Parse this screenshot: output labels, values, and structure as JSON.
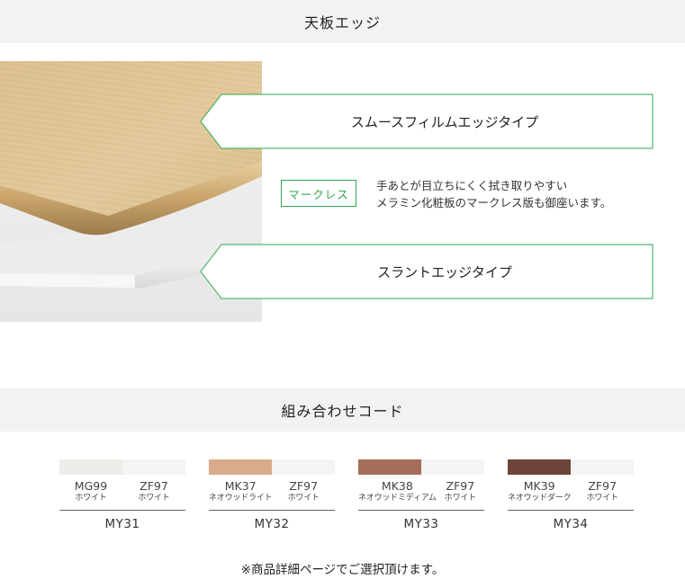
{
  "sections": {
    "edge_title": "天板エッジ",
    "combo_title": "組み合わせコード"
  },
  "edge": {
    "smooth_label": "スムースフィルムエッジタイプ",
    "slant_label": "スラントエッジタイプ",
    "badge": "マークレス",
    "desc_line1": "手あとが目立ちにくく拭き取りやすい",
    "desc_line2": "メラミン化粧板のマークレス版も御座います。"
  },
  "colors": {
    "accent_green": "#2ea84f",
    "oak": "#dcc294",
    "white_panel": "#f1f1f1"
  },
  "combos": [
    {
      "id": "MY31",
      "left": {
        "code": "MG99",
        "name": "ホワイト",
        "color": "#eeece8"
      },
      "right": {
        "code": "ZF97",
        "name": "ホワイト",
        "color": "#f4f4f2"
      }
    },
    {
      "id": "MY32",
      "left": {
        "code": "MK37",
        "name": "ネオウッドライト",
        "color": "#d9ab8c"
      },
      "right": {
        "code": "ZF97",
        "name": "ホワイト",
        "color": "#f4f4f2"
      }
    },
    {
      "id": "MY33",
      "left": {
        "code": "MK38",
        "name": "ネオウッドミディアム",
        "color": "#a46e5a"
      },
      "right": {
        "code": "ZF97",
        "name": "ホワイト",
        "color": "#f4f4f2"
      }
    },
    {
      "id": "MY34",
      "left": {
        "code": "MK39",
        "name": "ネオウッドダーク",
        "color": "#6e4438"
      },
      "right": {
        "code": "ZF97",
        "name": "ホワイト",
        "color": "#f4f4f2"
      }
    }
  ],
  "footer": {
    "note": "※商品詳細ページでご選択頂けます。"
  }
}
